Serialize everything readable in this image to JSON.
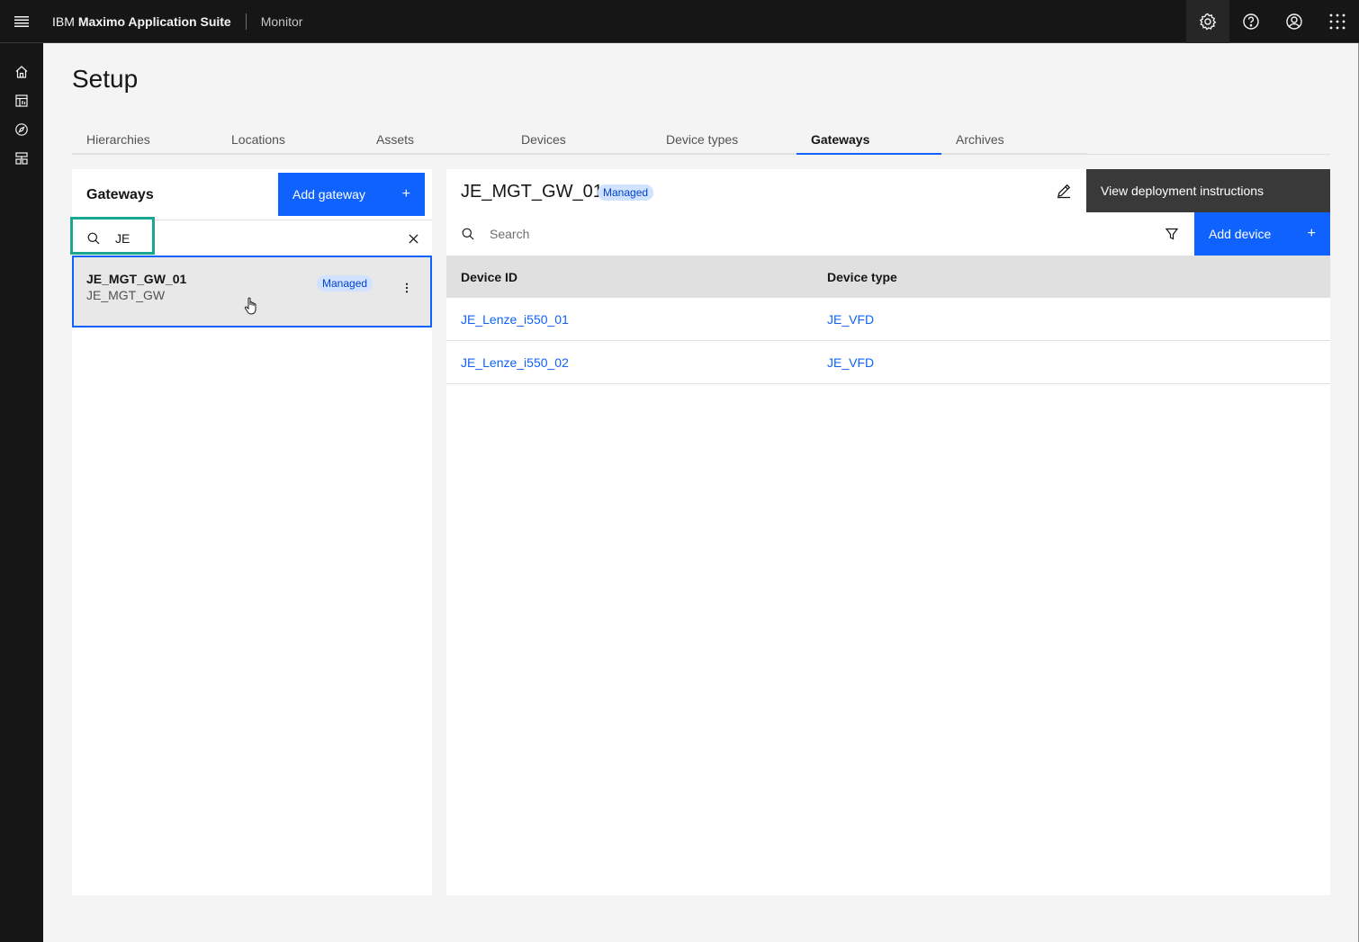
{
  "header": {
    "brand_ibm": "IBM",
    "brand_product": "Maximo Application Suite",
    "app_name": "Monitor",
    "icons": [
      "menu-icon",
      "settings-icon",
      "help-icon",
      "user-icon",
      "app-switcher-icon"
    ]
  },
  "siderail": {
    "icons": [
      "home-icon",
      "dashboard-icon",
      "compass-icon",
      "setup-icon"
    ]
  },
  "page": {
    "title": "Setup"
  },
  "tabs": [
    {
      "label": "Hierarchies",
      "selected": false
    },
    {
      "label": "Locations",
      "selected": false
    },
    {
      "label": "Assets",
      "selected": false
    },
    {
      "label": "Devices",
      "selected": false
    },
    {
      "label": "Device types",
      "selected": false
    },
    {
      "label": "Gateways",
      "selected": true
    },
    {
      "label": "Archives",
      "selected": false
    }
  ],
  "left_panel": {
    "title": "Gateways",
    "add_button": "Add gateway",
    "add_button_icon": "+",
    "search_value": "JE",
    "items": [
      {
        "name": "JE_MGT_GW_01",
        "type": "JE_MGT_GW",
        "tag": "Managed"
      }
    ]
  },
  "right_panel": {
    "title": "JE_MGT_GW_01",
    "tag": "Managed",
    "deploy_button": "View deployment instructions",
    "search_placeholder": "Search",
    "add_button": "Add device",
    "add_button_icon": "+",
    "columns": [
      "Device ID",
      "Device type"
    ],
    "rows": [
      {
        "device_id": "JE_Lenze_i550_01",
        "device_type": "JE_VFD"
      },
      {
        "device_id": "JE_Lenze_i550_02",
        "device_type": "JE_VFD"
      }
    ]
  },
  "colors": {
    "primary": "#0f62fe",
    "header_bg": "#161616",
    "tag_bg": "#d0e2ff",
    "highlight": "#1ba690"
  }
}
